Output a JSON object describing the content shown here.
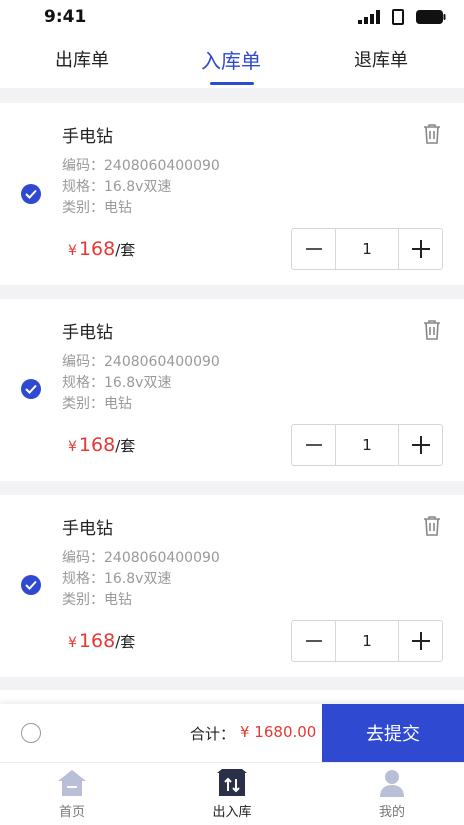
{
  "status": {
    "time": "9:41"
  },
  "tabs": [
    {
      "label": "出库单"
    },
    {
      "label": "入库单"
    },
    {
      "label": "退库单"
    }
  ],
  "colors": {
    "accent": "#2f4ad0",
    "price": "#e53935"
  },
  "items": [
    {
      "name": "手电钻",
      "code": "编码：2408060400090",
      "spec": "规格：16.8v双速",
      "category": "类别：电钻",
      "currency": "¥",
      "price": "168",
      "unit": "/套",
      "qty": "1",
      "checked": true
    },
    {
      "name": "手电钻",
      "code": "编码：2408060400090",
      "spec": "规格：16.8v双速",
      "category": "类别：电钻",
      "currency": "¥",
      "price": "168",
      "unit": "/套",
      "qty": "1",
      "checked": true
    },
    {
      "name": "手电钻",
      "code": "编码：2408060400090",
      "spec": "规格：16.8v双速",
      "category": "类别：电钻",
      "currency": "¥",
      "price": "168",
      "unit": "/套",
      "qty": "1",
      "checked": true
    }
  ],
  "footer": {
    "total_label": "合计：",
    "total_value": "¥ 1680.00",
    "submit_label": "去提交",
    "select_all_checked": false
  },
  "nav": [
    {
      "label": "首页",
      "icon": "home-icon"
    },
    {
      "label": "出入库",
      "icon": "warehouse-icon"
    },
    {
      "label": "我的",
      "icon": "user-icon"
    }
  ]
}
